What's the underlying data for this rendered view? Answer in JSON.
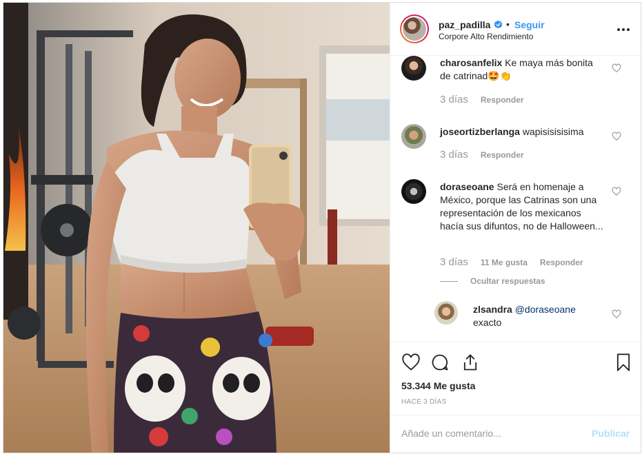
{
  "post": {
    "username": "paz_padilla",
    "follow_label": "Seguir",
    "separator": "•",
    "location": "Corpore Alto Rendimiento",
    "icons": [
      "verified-badge-icon",
      "more-options-icon"
    ]
  },
  "comments": [
    {
      "username": "charosanfelix",
      "text": "Ke maya más bonita de catrinad",
      "emoji": "🤩👏",
      "time": "3 días",
      "reply_label": "Responder"
    },
    {
      "username": "joseortizberlanga",
      "text": "wapisisisisima",
      "time": "3 días",
      "reply_label": "Responder"
    },
    {
      "username": "doraseoane",
      "text": "Será en homenaje a México, porque las Catrinas son una representación de los mexicanos hacía sus difuntos, no de Halloween...",
      "time": "3 días",
      "likes_label": "11 Me gusta",
      "reply_label": "Responder",
      "hide_replies_label": "Ocultar respuestas"
    }
  ],
  "reply": {
    "username": "zlsandra",
    "mention": "@doraseoane",
    "text": "exacto"
  },
  "footer": {
    "likes": "53.344 Me gusta",
    "time_ago": "HACE 3 DÍAS",
    "comment_placeholder": "Añade un comentario...",
    "publish_label": "Publicar",
    "icons": [
      "heart-icon",
      "comment-icon",
      "share-icon",
      "bookmark-icon"
    ]
  },
  "colors": {
    "link_blue": "#3897f0",
    "publish_disabled": "#b2dffc",
    "muted_text": "#999999",
    "border": "#dbdbdb"
  }
}
